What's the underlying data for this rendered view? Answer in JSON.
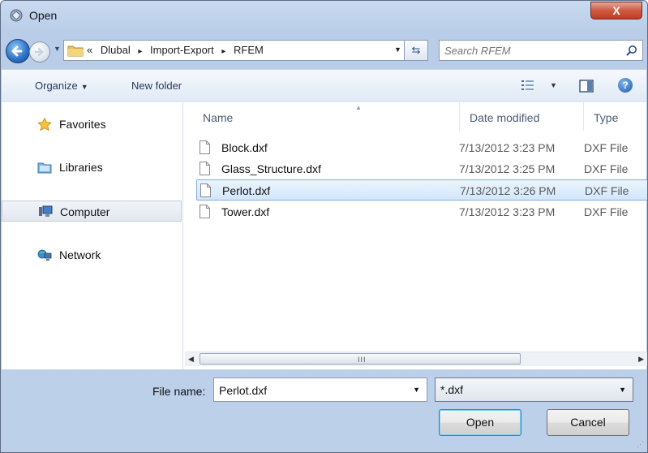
{
  "window": {
    "title": "Open",
    "close_glyph": "X"
  },
  "address": {
    "overflow": "«",
    "crumbs": [
      "Dlubal",
      "Import-Export",
      "RFEM"
    ],
    "separator": "▸",
    "search_placeholder": "Search RFEM"
  },
  "toolbar": {
    "organize_label": "Organize",
    "new_folder_label": "New folder",
    "help_glyph": "?"
  },
  "nav_pane": {
    "items": [
      {
        "label": "Favorites",
        "icon": "star-icon",
        "selected": false
      },
      {
        "label": "Libraries",
        "icon": "libraries-icon",
        "selected": false
      },
      {
        "label": "Computer",
        "icon": "computer-icon",
        "selected": true
      },
      {
        "label": "Network",
        "icon": "network-icon",
        "selected": false
      }
    ]
  },
  "file_list": {
    "columns": [
      "Name",
      "Date modified",
      "Type"
    ],
    "rows": [
      {
        "name": "Block.dxf",
        "date": "7/13/2012 3:23 PM",
        "type": "DXF File",
        "selected": false
      },
      {
        "name": "Glass_Structure.dxf",
        "date": "7/13/2012 3:25 PM",
        "type": "DXF File",
        "selected": false
      },
      {
        "name": "Perlot.dxf",
        "date": "7/13/2012 3:26 PM",
        "type": "DXF File",
        "selected": true
      },
      {
        "name": "Tower.dxf",
        "date": "7/13/2012 3:23 PM",
        "type": "DXF File",
        "selected": false
      }
    ],
    "scroll_grip": "III"
  },
  "bottom": {
    "file_name_label": "File name:",
    "file_name_value": "Perlot.dxf",
    "filter_value": "*.dxf",
    "open_label": "Open",
    "cancel_label": "Cancel"
  },
  "colors": {
    "accent": "#3c7fb1",
    "selection": "#d3e7fb",
    "close": "#c23a1f"
  }
}
